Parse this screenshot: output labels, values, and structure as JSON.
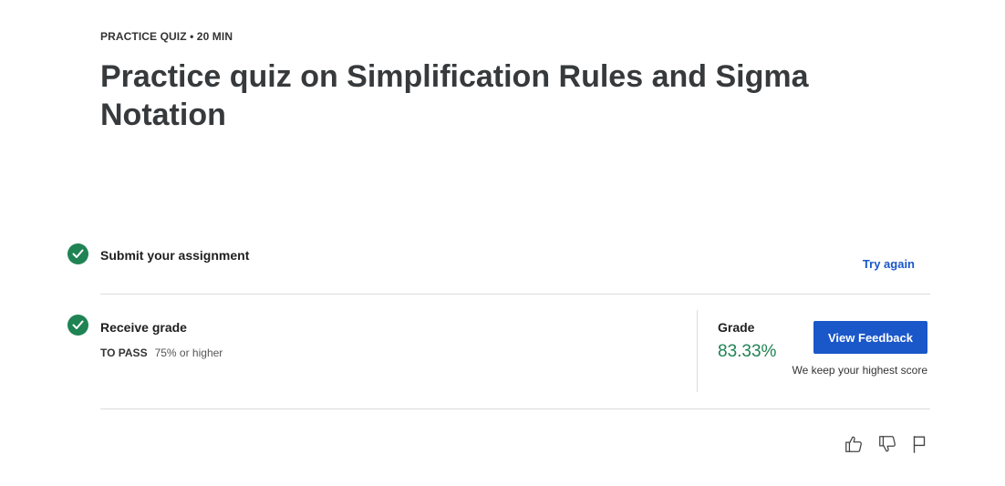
{
  "header": {
    "eyebrow": "PRACTICE QUIZ • 20 MIN",
    "title": "Practice quiz on Simplification Rules and Sigma Notation"
  },
  "steps": {
    "submit": {
      "label": "Submit your assignment",
      "action": "Try again",
      "status_icon": "check-circle-icon"
    },
    "grade": {
      "label": "Receive grade",
      "pass_key": "TO PASS",
      "pass_value": "75% or higher",
      "status_icon": "check-circle-icon"
    }
  },
  "result": {
    "grade_label": "Grade",
    "grade_value": "83.33%",
    "button_label": "View Feedback",
    "note": "We keep your highest score"
  },
  "footer_icons": [
    "thumbs-up-icon",
    "thumbs-down-icon",
    "flag-icon"
  ],
  "colors": {
    "accent_blue": "#1a57c9",
    "success_green": "#1f8354",
    "title_text": "#373a3c",
    "divider": "#dcdcdc"
  }
}
